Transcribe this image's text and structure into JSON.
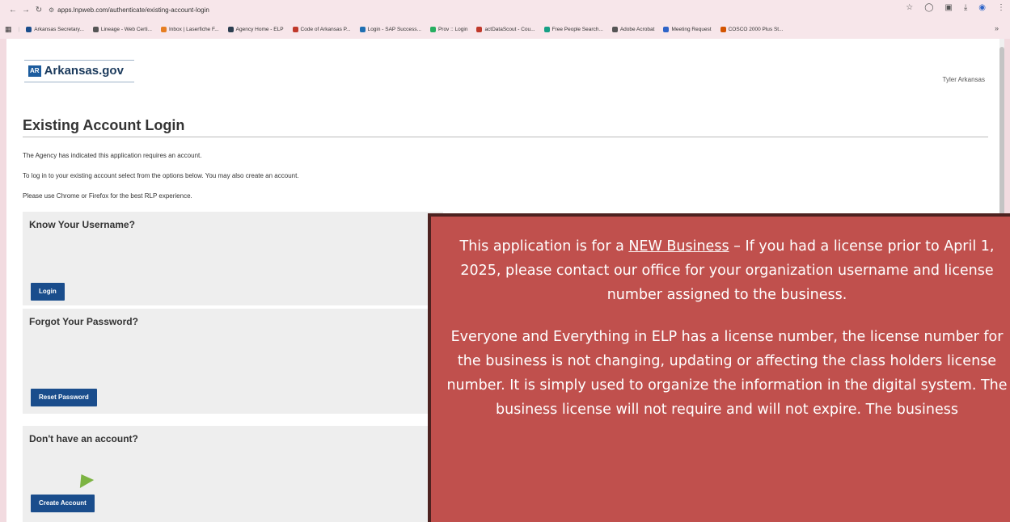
{
  "browser": {
    "url": "apps.lnpweb.com/authenticate/existing-account-login",
    "bookmarks": [
      {
        "label": "Arkansas Secretary...",
        "color": "#1a4d8c"
      },
      {
        "label": "Lineage - Web Certi...",
        "color": "#555555"
      },
      {
        "label": "Inbox | Laserfiche F...",
        "color": "#e67e22"
      },
      {
        "label": "Agency Home - ELP",
        "color": "#2c3e50"
      },
      {
        "label": "Code of Arkansas P...",
        "color": "#c0392b"
      },
      {
        "label": "Login - SAP Success...",
        "color": "#1f6fb2"
      },
      {
        "label": "Prov :: Login",
        "color": "#27ae60"
      },
      {
        "label": "actDataScout - Cou...",
        "color": "#c0392b"
      },
      {
        "label": "Free People Search...",
        "color": "#16a085"
      },
      {
        "label": "Adobe Acrobat",
        "color": "#555555"
      },
      {
        "label": "Meeting Request",
        "color": "#2e64c8"
      },
      {
        "label": "COSCO 2000 Plus St...",
        "color": "#d35400"
      }
    ],
    "more": "»"
  },
  "header": {
    "badge": "AR",
    "brand": "Arkansas.gov",
    "user": "Tyler Arkansas"
  },
  "main": {
    "title": "Existing Account Login",
    "intro": [
      "The Agency has indicated this application requires an account.",
      "To log in to your existing account select from the options below. You may also create an account.",
      "Please use Chrome or Firefox for the best RLP experience."
    ],
    "panels": [
      {
        "heading": "Know Your Username?",
        "button": "Login"
      },
      {
        "heading": "Forgot Your Password?",
        "button": "Reset Password"
      },
      {
        "heading": "Don't have an account?",
        "button": "Create Account"
      }
    ]
  },
  "notice": {
    "p1_before": "This application is for a ",
    "p1_link": "NEW Business",
    "p1_after": " – If you had a license prior to April 1, 2025, please contact our office for your organization username and license number assigned to the business.",
    "p2": "Everyone and Everything in ELP has a license number, the license number for the business is not changing, updating or affecting the class holders license number. It is simply used to organize the information in the digital system. The business license will not require and will not expire. The business"
  }
}
